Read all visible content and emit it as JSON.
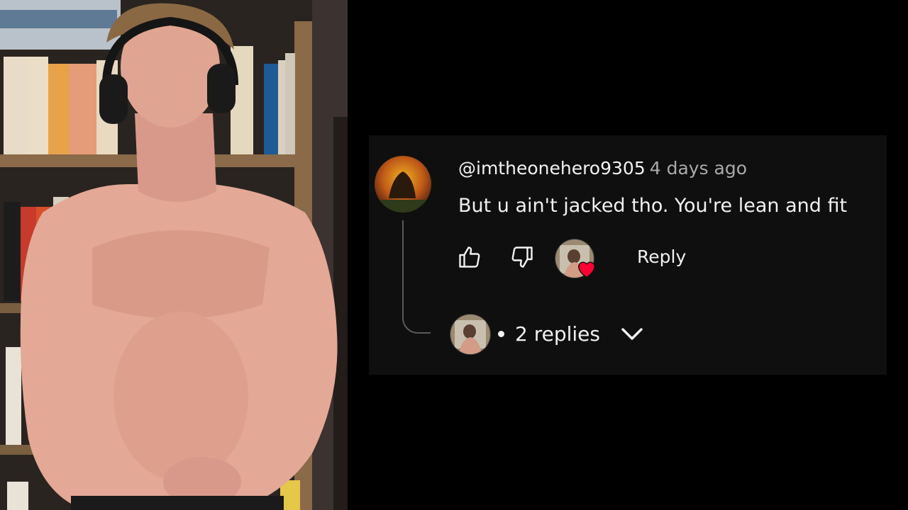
{
  "comment": {
    "handle": "@imtheonehero9305",
    "time": "4 days ago",
    "text": "But u ain't jacked tho. You're lean and fit",
    "reply_label": "Reply",
    "replies_label": "2 replies"
  },
  "icons": {
    "like": "thumbs-up-icon",
    "dislike": "thumbs-down-icon",
    "creator_heart": "creator-heart-icon",
    "expand": "chevron-down-icon"
  },
  "colors": {
    "card_bg": "#0f0f0f",
    "text": "#f1f1f1",
    "muted": "#aaaaaa",
    "heart": "#ff0033"
  }
}
